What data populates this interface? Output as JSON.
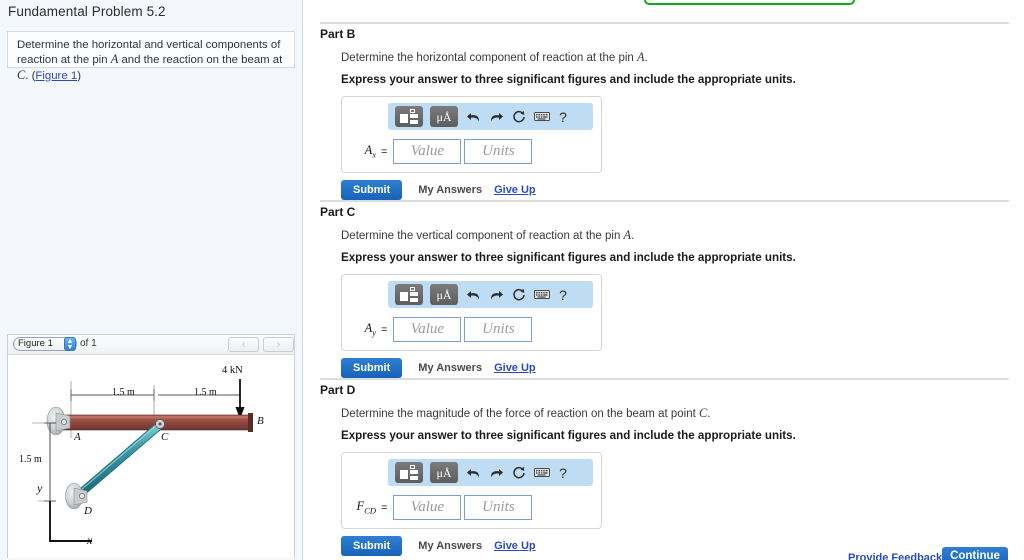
{
  "left": {
    "problem_title": "Fundamental Problem 5.2",
    "statement_prefix": "Determine the horizontal and vertical components of reaction at the pin ",
    "statement_pin": "A",
    "statement_middle": " and the reaction on the beam at ",
    "statement_point": "C",
    "statement_suffix": ". (",
    "figure_link": "Figure 1",
    "statement_end": ")"
  },
  "figure_viewer": {
    "selected_figure": "Figure 1",
    "of_label": "of 1",
    "prev_icon": "‹",
    "next_icon": "›",
    "select_arrows": "▴▾"
  },
  "figure": {
    "load_label": "4 kN",
    "dim_top_left": "1.5 m",
    "dim_top_right": "1.5 m",
    "dim_vertical": "1.5 m",
    "label_A": "A",
    "label_B": "B",
    "label_C": "C",
    "label_D": "D",
    "axis_x": "x",
    "axis_y": "y",
    "colors": {
      "beam": "#8c4a3f",
      "beam_highlight": "#b8655a",
      "strut": "#2e8b99",
      "strut_highlight": "#6fc3cc",
      "support": "#b9bcbe"
    }
  },
  "parts": [
    {
      "heading": "Part B",
      "prompt_prefix": "Determine the horizontal component of reaction at the pin ",
      "prompt_symbol": "A",
      "prompt_suffix": ".",
      "instruction": "Express your answer to three significant figures and include the appropriate units.",
      "answer_symbol": "A",
      "answer_subscript": "x",
      "equals": "=",
      "value_placeholder": "Value",
      "units_placeholder": "Units",
      "submit_label": "Submit",
      "my_answers_label": "My Answers",
      "give_up_label": "Give Up"
    },
    {
      "heading": "Part C",
      "prompt_prefix": "Determine the vertical component of reaction at the pin ",
      "prompt_symbol": "A",
      "prompt_suffix": ".",
      "instruction": "Express your answer to three significant figures and include the appropriate units.",
      "answer_symbol": "A",
      "answer_subscript": "y",
      "equals": "=",
      "value_placeholder": "Value",
      "units_placeholder": "Units",
      "submit_label": "Submit",
      "my_answers_label": "My Answers",
      "give_up_label": "Give Up"
    },
    {
      "heading": "Part D",
      "prompt_prefix": "Determine the magnitude of the force of reaction on the beam at point ",
      "prompt_symbol": "C",
      "prompt_suffix": ".",
      "instruction": "Express your answer to three significant figures and include the appropriate units.",
      "answer_symbol": "F",
      "answer_subscript": "CD",
      "equals": "=",
      "value_placeholder": "Value",
      "units_placeholder": "Units",
      "submit_label": "Submit",
      "my_answers_label": "My Answers",
      "give_up_label": "Give Up"
    }
  ],
  "mathbar": {
    "template_icon": "template-icon",
    "units_label": "μÅ",
    "undo_icon": "undo-icon",
    "redo_icon": "redo-icon",
    "reset_icon": "↺",
    "keyboard_icon": "keyboard-icon",
    "help_label": "?"
  },
  "footer": {
    "provide_feedback": "Provide Feedback",
    "continue_label": "Continue"
  },
  "colors": {
    "accent_blue": "#1763b8",
    "link_blue": "#2a4bbd",
    "mathbar_bg": "#bfdcf5",
    "panel_bg": "#f4f8fd",
    "green_border": "#1aa81a"
  }
}
